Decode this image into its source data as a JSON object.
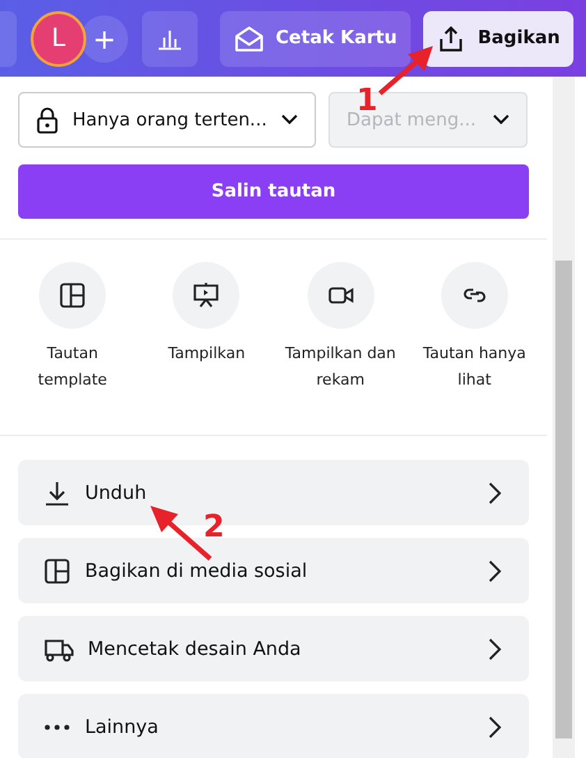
{
  "topbar": {
    "avatar": "L",
    "add": "+",
    "print_button": "Cetak Kartu",
    "share_button": {
      "label": "Bagikan",
      "selected": true
    }
  },
  "access": {
    "who": "Hanya orang terten...",
    "permission": {
      "value": "Dapat meng...",
      "disabled": true
    }
  },
  "copy_button": "Salin tautan",
  "quick_actions": [
    {
      "kind": "template",
      "label": "Tautan template"
    },
    {
      "kind": "present",
      "label": "Tampilkan"
    },
    {
      "kind": "record",
      "label": "Tampilkan dan rekam"
    },
    {
      "kind": "viewlink",
      "label": "Tautan hanya lihat"
    }
  ],
  "options": [
    {
      "kind": "download",
      "label": "Unduh"
    },
    {
      "kind": "social",
      "label": "Bagikan di media sosial"
    },
    {
      "kind": "print",
      "label": "Mencetak desain Anda"
    },
    {
      "kind": "more",
      "label": "Lainnya"
    }
  ],
  "annotations": [
    "1",
    "2"
  ]
}
